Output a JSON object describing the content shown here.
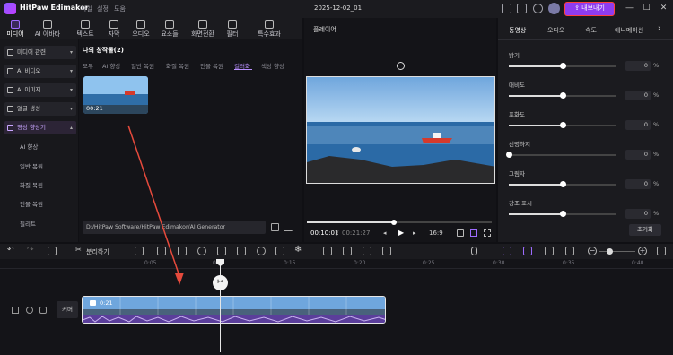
{
  "app": {
    "name": "HitPaw Edimakor",
    "menu": [
      "파일",
      "설정",
      "도움"
    ],
    "project_title": "2025-12-02_01",
    "export_label": "내보내기",
    "window": [
      "—",
      "☐",
      "✕"
    ]
  },
  "top_tabs": [
    "미디어",
    "AI 아바타",
    "텍스트",
    "자막",
    "오디오",
    "요소들",
    "화면전환",
    "필터",
    "특수효과"
  ],
  "sidebar": {
    "items": [
      "미디어 관련",
      "AI 비디오",
      "AI 이미지",
      "얼굴 생성",
      "영상 향상기"
    ],
    "subitems": [
      "AI 향상",
      "일반 복원",
      "화질 복원",
      "인물 복원",
      "필리트"
    ]
  },
  "library": {
    "title": "나의 창작물(2)",
    "tabs": [
      "모두",
      "AI 향상",
      "일반 복원",
      "화질 복원",
      "인물 복원",
      "컬러화",
      "색상 향상"
    ],
    "active_tab": "컬러화",
    "clip_duration": "00:21",
    "path": "D:/HitPaw Software/HitPaw Edimakor/AI Generator"
  },
  "player": {
    "label": "플레이어",
    "current": "00:10:01",
    "total": "00:21:27",
    "ratio": "16:9",
    "progress": 0.47
  },
  "props": {
    "tabs": [
      "동영상",
      "오디오",
      "속도",
      "애니메이션"
    ],
    "rows": [
      {
        "label": "밝기",
        "value": "0"
      },
      {
        "label": "대비도",
        "value": "0"
      },
      {
        "label": "포화도",
        "value": "0"
      },
      {
        "label": "선명하지",
        "value": "0"
      },
      {
        "label": "그림자",
        "value": "0"
      },
      {
        "label": "강조 표시",
        "value": "0"
      }
    ],
    "unit": "%",
    "reset_label": "초기화"
  },
  "timeline": {
    "split_label": "분리하기",
    "ruler": [
      "0:05",
      "0:10",
      "0:15",
      "0:20",
      "0:25",
      "0:30",
      "0:35",
      "0:40"
    ],
    "track_label": "커버",
    "clip_duration": "0:21"
  }
}
